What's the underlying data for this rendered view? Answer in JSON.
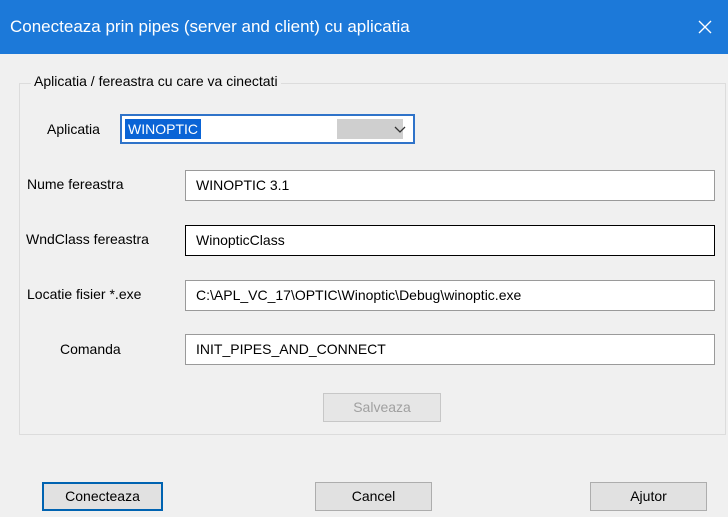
{
  "window": {
    "title": "Conecteaza prin pipes (server and client) cu aplicatia",
    "close_icon": "close-icon"
  },
  "group": {
    "legend": "Aplicatia / fereastra cu care va cinectati"
  },
  "fields": {
    "aplicatia": {
      "label": "Aplicatia",
      "value": "WINOPTIC"
    },
    "nume_fereastra": {
      "label": "Nume fereastra",
      "value": "WINOPTIC 3.1"
    },
    "wndclass": {
      "label": "WndClass fereastra",
      "value": "WinopticClass"
    },
    "locatie": {
      "label": "Locatie fisier *.exe",
      "value": "C:\\APL_VC_17\\OPTIC\\Winoptic\\Debug\\winoptic.exe"
    },
    "comanda": {
      "label": "Comanda",
      "value": "INIT_PIPES_AND_CONNECT"
    }
  },
  "buttons": {
    "salveaza": "Salveaza",
    "conecteaza": "Conecteaza",
    "cancel": "Cancel",
    "ajutor": "Ajutor"
  },
  "colors": {
    "titlebar": "#1c79d9",
    "selection": "#0a64d6",
    "focus_border": "#2f73c9",
    "default_button_border": "#0063b1"
  }
}
